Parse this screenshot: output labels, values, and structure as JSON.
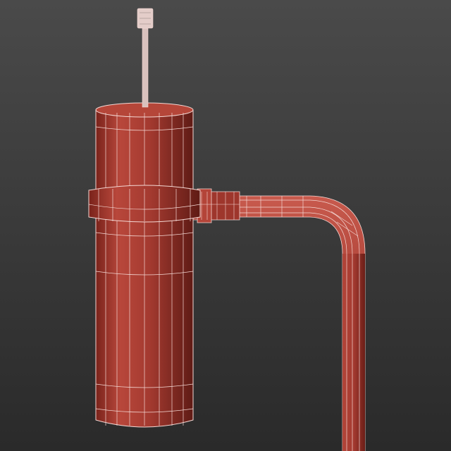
{
  "viewport": {
    "background_top": "#4a4a4a",
    "background_bottom": "#2a2a2a"
  },
  "model": {
    "subject": "wireframe-cylindrical-lamp-on-bent-pipe",
    "base_color": "#a8382e",
    "shade_light": "#c24a3e",
    "shade_dark": "#6e1f18",
    "wire_color": "#f4d8d4",
    "antenna_color": "#e9d3cf"
  }
}
